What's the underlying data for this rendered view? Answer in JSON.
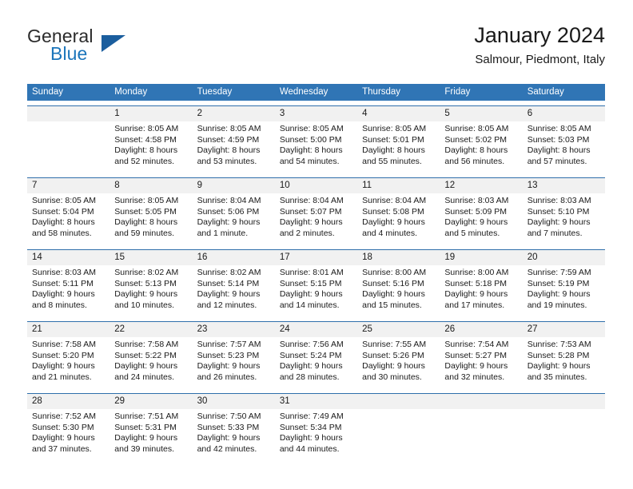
{
  "brand": {
    "name_top": "General",
    "name_bottom": "Blue",
    "accent_color": "#1b75bb",
    "triangle_color": "#1b5e9e"
  },
  "header": {
    "title": "January 2024",
    "subtitle": "Salmour, Piedmont, Italy"
  },
  "theme": {
    "header_row_bg": "#3075b5",
    "week_divider": "#2f6fab",
    "day_number_bg": "#f1f1f1"
  },
  "weekdays": [
    "Sunday",
    "Monday",
    "Tuesday",
    "Wednesday",
    "Thursday",
    "Friday",
    "Saturday"
  ],
  "weeks": [
    {
      "days": [
        {
          "number": "",
          "lines": [
            "",
            "",
            "",
            ""
          ]
        },
        {
          "number": "1",
          "lines": [
            "Sunrise: 8:05 AM",
            "Sunset: 4:58 PM",
            "Daylight: 8 hours",
            "and 52 minutes."
          ]
        },
        {
          "number": "2",
          "lines": [
            "Sunrise: 8:05 AM",
            "Sunset: 4:59 PM",
            "Daylight: 8 hours",
            "and 53 minutes."
          ]
        },
        {
          "number": "3",
          "lines": [
            "Sunrise: 8:05 AM",
            "Sunset: 5:00 PM",
            "Daylight: 8 hours",
            "and 54 minutes."
          ]
        },
        {
          "number": "4",
          "lines": [
            "Sunrise: 8:05 AM",
            "Sunset: 5:01 PM",
            "Daylight: 8 hours",
            "and 55 minutes."
          ]
        },
        {
          "number": "5",
          "lines": [
            "Sunrise: 8:05 AM",
            "Sunset: 5:02 PM",
            "Daylight: 8 hours",
            "and 56 minutes."
          ]
        },
        {
          "number": "6",
          "lines": [
            "Sunrise: 8:05 AM",
            "Sunset: 5:03 PM",
            "Daylight: 8 hours",
            "and 57 minutes."
          ]
        }
      ]
    },
    {
      "days": [
        {
          "number": "7",
          "lines": [
            "Sunrise: 8:05 AM",
            "Sunset: 5:04 PM",
            "Daylight: 8 hours",
            "and 58 minutes."
          ]
        },
        {
          "number": "8",
          "lines": [
            "Sunrise: 8:05 AM",
            "Sunset: 5:05 PM",
            "Daylight: 8 hours",
            "and 59 minutes."
          ]
        },
        {
          "number": "9",
          "lines": [
            "Sunrise: 8:04 AM",
            "Sunset: 5:06 PM",
            "Daylight: 9 hours",
            "and 1 minute."
          ]
        },
        {
          "number": "10",
          "lines": [
            "Sunrise: 8:04 AM",
            "Sunset: 5:07 PM",
            "Daylight: 9 hours",
            "and 2 minutes."
          ]
        },
        {
          "number": "11",
          "lines": [
            "Sunrise: 8:04 AM",
            "Sunset: 5:08 PM",
            "Daylight: 9 hours",
            "and 4 minutes."
          ]
        },
        {
          "number": "12",
          "lines": [
            "Sunrise: 8:03 AM",
            "Sunset: 5:09 PM",
            "Daylight: 9 hours",
            "and 5 minutes."
          ]
        },
        {
          "number": "13",
          "lines": [
            "Sunrise: 8:03 AM",
            "Sunset: 5:10 PM",
            "Daylight: 9 hours",
            "and 7 minutes."
          ]
        }
      ]
    },
    {
      "days": [
        {
          "number": "14",
          "lines": [
            "Sunrise: 8:03 AM",
            "Sunset: 5:11 PM",
            "Daylight: 9 hours",
            "and 8 minutes."
          ]
        },
        {
          "number": "15",
          "lines": [
            "Sunrise: 8:02 AM",
            "Sunset: 5:13 PM",
            "Daylight: 9 hours",
            "and 10 minutes."
          ]
        },
        {
          "number": "16",
          "lines": [
            "Sunrise: 8:02 AM",
            "Sunset: 5:14 PM",
            "Daylight: 9 hours",
            "and 12 minutes."
          ]
        },
        {
          "number": "17",
          "lines": [
            "Sunrise: 8:01 AM",
            "Sunset: 5:15 PM",
            "Daylight: 9 hours",
            "and 14 minutes."
          ]
        },
        {
          "number": "18",
          "lines": [
            "Sunrise: 8:00 AM",
            "Sunset: 5:16 PM",
            "Daylight: 9 hours",
            "and 15 minutes."
          ]
        },
        {
          "number": "19",
          "lines": [
            "Sunrise: 8:00 AM",
            "Sunset: 5:18 PM",
            "Daylight: 9 hours",
            "and 17 minutes."
          ]
        },
        {
          "number": "20",
          "lines": [
            "Sunrise: 7:59 AM",
            "Sunset: 5:19 PM",
            "Daylight: 9 hours",
            "and 19 minutes."
          ]
        }
      ]
    },
    {
      "days": [
        {
          "number": "21",
          "lines": [
            "Sunrise: 7:58 AM",
            "Sunset: 5:20 PM",
            "Daylight: 9 hours",
            "and 21 minutes."
          ]
        },
        {
          "number": "22",
          "lines": [
            "Sunrise: 7:58 AM",
            "Sunset: 5:22 PM",
            "Daylight: 9 hours",
            "and 24 minutes."
          ]
        },
        {
          "number": "23",
          "lines": [
            "Sunrise: 7:57 AM",
            "Sunset: 5:23 PM",
            "Daylight: 9 hours",
            "and 26 minutes."
          ]
        },
        {
          "number": "24",
          "lines": [
            "Sunrise: 7:56 AM",
            "Sunset: 5:24 PM",
            "Daylight: 9 hours",
            "and 28 minutes."
          ]
        },
        {
          "number": "25",
          "lines": [
            "Sunrise: 7:55 AM",
            "Sunset: 5:26 PM",
            "Daylight: 9 hours",
            "and 30 minutes."
          ]
        },
        {
          "number": "26",
          "lines": [
            "Sunrise: 7:54 AM",
            "Sunset: 5:27 PM",
            "Daylight: 9 hours",
            "and 32 minutes."
          ]
        },
        {
          "number": "27",
          "lines": [
            "Sunrise: 7:53 AM",
            "Sunset: 5:28 PM",
            "Daylight: 9 hours",
            "and 35 minutes."
          ]
        }
      ]
    },
    {
      "days": [
        {
          "number": "28",
          "lines": [
            "Sunrise: 7:52 AM",
            "Sunset: 5:30 PM",
            "Daylight: 9 hours",
            "and 37 minutes."
          ]
        },
        {
          "number": "29",
          "lines": [
            "Sunrise: 7:51 AM",
            "Sunset: 5:31 PM",
            "Daylight: 9 hours",
            "and 39 minutes."
          ]
        },
        {
          "number": "30",
          "lines": [
            "Sunrise: 7:50 AM",
            "Sunset: 5:33 PM",
            "Daylight: 9 hours",
            "and 42 minutes."
          ]
        },
        {
          "number": "31",
          "lines": [
            "Sunrise: 7:49 AM",
            "Sunset: 5:34 PM",
            "Daylight: 9 hours",
            "and 44 minutes."
          ]
        },
        {
          "number": "",
          "lines": [
            "",
            "",
            "",
            ""
          ]
        },
        {
          "number": "",
          "lines": [
            "",
            "",
            "",
            ""
          ]
        },
        {
          "number": "",
          "lines": [
            "",
            "",
            "",
            ""
          ]
        }
      ]
    }
  ]
}
